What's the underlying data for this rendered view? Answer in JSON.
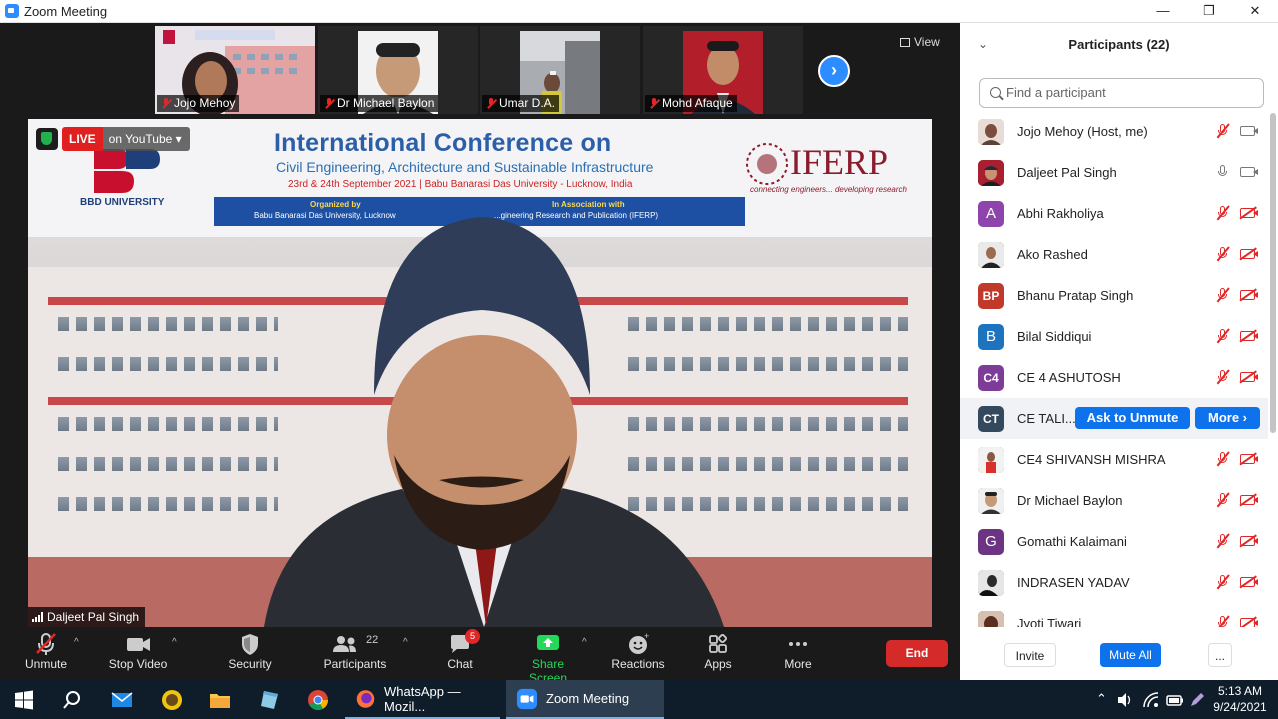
{
  "window": {
    "title": "Zoom Meeting",
    "controls": [
      "—",
      "❐",
      "✕"
    ]
  },
  "gallery": {
    "thumbnails": [
      {
        "name": "Jojo Mehoy"
      },
      {
        "name": "Dr Michael Baylon"
      },
      {
        "name": "Umar D.A."
      },
      {
        "name": "Mohd Afaque"
      }
    ],
    "view_label": "View"
  },
  "main_video": {
    "live_label": "LIVE",
    "stream_label": "on YouTube",
    "speaker": "Daljeet Pal Singh",
    "banner": {
      "university": "BBD UNIVERSITY",
      "title": "International Conference on",
      "subtitle": "Civil Engineering, Architecture and Sustainable Infrastructure",
      "dates": "23rd & 24th September 2021  |  Babu Banarasi Das University - Lucknow, India",
      "organized_by_label": "Organized by",
      "organized_by": "Babu Banarasi Das University, Lucknow",
      "association_label": "In Association with",
      "association": "...gineering Research and Publication (IFERP)",
      "iferp": "IFERP",
      "iferp_tagline": "connecting engineers... developing research"
    }
  },
  "toolbar": {
    "unmute": "Unmute",
    "stop_video": "Stop Video",
    "security": "Security",
    "participants": "Participants",
    "participants_count": "22",
    "chat": "Chat",
    "chat_badge": "5",
    "share_screen": "Share Screen",
    "reactions": "Reactions",
    "apps": "Apps",
    "more": "More",
    "end": "End"
  },
  "participants_panel": {
    "title": "Participants (22)",
    "search_placeholder": "Find a participant",
    "participants": [
      {
        "name": "Jojo Mehoy (Host, me)",
        "avatar": "",
        "avatar_color": "#8d6e63",
        "mic": "off",
        "cam": "on"
      },
      {
        "name": "Daljeet Pal Singh",
        "avatar": "",
        "avatar_color": "#7b1f2a",
        "mic": "on",
        "cam": "on"
      },
      {
        "name": "Abhi Rakholiya",
        "avatar": "A",
        "avatar_color": "#8e44ad",
        "mic": "off",
        "cam": "off"
      },
      {
        "name": "Ako Rashed",
        "avatar": "",
        "avatar_color": "#3b3b3b",
        "mic": "off",
        "cam": "off"
      },
      {
        "name": "Bhanu Pratap Singh",
        "avatar": "BP",
        "avatar_color": "#c0392b",
        "mic": "off",
        "cam": "off"
      },
      {
        "name": "Bilal Siddiqui",
        "avatar": "B",
        "avatar_color": "#1e73be",
        "mic": "off",
        "cam": "off"
      },
      {
        "name": "CE 4 ASHUTOSH",
        "avatar": "C4",
        "avatar_color": "#7d3c98",
        "mic": "off",
        "cam": "off"
      },
      {
        "name": "CE TALI...",
        "avatar": "CT",
        "avatar_color": "#34495e",
        "mic": "",
        "cam": ""
      },
      {
        "name": "CE4 SHIVANSH MISHRA",
        "avatar": "",
        "avatar_color": "#b03a2e",
        "mic": "off",
        "cam": "off"
      },
      {
        "name": "Dr Michael Baylon",
        "avatar": "",
        "avatar_color": "#5d4037",
        "mic": "off",
        "cam": "off"
      },
      {
        "name": "Gomathi Kalaimani",
        "avatar": "G",
        "avatar_color": "#6c3483",
        "mic": "off",
        "cam": "off"
      },
      {
        "name": "INDRASEN YADAV",
        "avatar": "",
        "avatar_color": "#444444",
        "mic": "off",
        "cam": "off"
      },
      {
        "name": "Jyoti Tiwari",
        "avatar": "",
        "avatar_color": "#a04000",
        "mic": "off",
        "cam": "off"
      }
    ],
    "ask_to_unmute": "Ask to Unmute",
    "more_label": "More ›",
    "footer": {
      "invite": "Invite",
      "mute_all": "Mute All",
      "more": "..."
    }
  },
  "taskbar": {
    "apps": [
      {
        "label": "WhatsApp — Mozil..."
      },
      {
        "label": "Zoom Meeting"
      }
    ],
    "time": "5:13 AM",
    "date": "9/24/2021"
  }
}
